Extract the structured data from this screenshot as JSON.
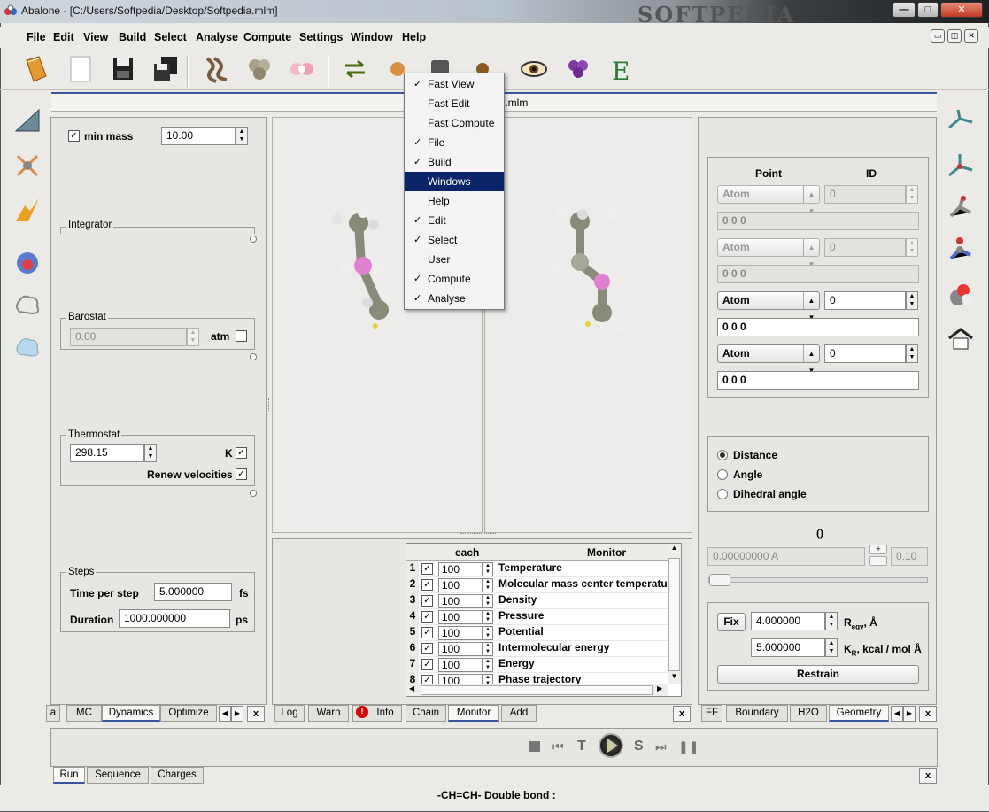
{
  "window": {
    "title": "Abalone - [C:/Users/Softpedia/Desktop/Softpedia.mlm]",
    "watermark": "SOFTPEDIA",
    "min": "—",
    "max": "□",
    "close": "✕"
  },
  "menubar": [
    "File",
    "Edit",
    "View",
    "Build",
    "Select",
    "Analyse",
    "Compute",
    "Settings",
    "Window",
    "Help"
  ],
  "document_tab": "Softpedia.mlm",
  "left_panel": {
    "min_mass_label": "min mass",
    "min_mass_value": "10.00",
    "integrator_title": "Integrator",
    "barostat_title": "Barostat",
    "barostat_value": "0.00",
    "barostat_unit": "atm",
    "thermostat_title": "Thermostat",
    "thermostat_value": "298.15",
    "thermostat_unit": "K",
    "renew_label": "Renew velocities",
    "steps_title": "Steps",
    "time_per_step_label": "Time per step",
    "time_per_step_value": "5.000000",
    "time_unit": "fs",
    "duration_label": "Duration",
    "duration_value": "1000.000000",
    "duration_unit": "ps",
    "tabs": [
      "a",
      "MC",
      "Dynamics",
      "Optimize"
    ]
  },
  "popup_menu": [
    {
      "label": "Fast View",
      "checked": "✓"
    },
    {
      "label": "Fast Edit",
      "checked": ""
    },
    {
      "label": "Fast Compute",
      "checked": ""
    },
    {
      "label": "File",
      "checked": "✓"
    },
    {
      "label": "Build",
      "checked": "✓"
    },
    {
      "label": "Windows",
      "checked": ""
    },
    {
      "label": "Help",
      "checked": ""
    },
    {
      "label": "Edit",
      "checked": "✓"
    },
    {
      "label": "Select",
      "checked": "✓"
    },
    {
      "label": "User",
      "checked": ""
    },
    {
      "label": "Compute",
      "checked": "✓"
    },
    {
      "label": "Analyse",
      "checked": "✓"
    }
  ],
  "monitor": {
    "col_each": "each",
    "col_monitor": "Monitor",
    "rows": [
      {
        "n": "1",
        "each": "100",
        "name": "Temperature"
      },
      {
        "n": "2",
        "each": "100",
        "name": "Molecular mass center temperatur"
      },
      {
        "n": "3",
        "each": "100",
        "name": "Density"
      },
      {
        "n": "4",
        "each": "100",
        "name": "Pressure"
      },
      {
        "n": "5",
        "each": "100",
        "name": "Potential"
      },
      {
        "n": "6",
        "each": "100",
        "name": "Intermolecular energy"
      },
      {
        "n": "7",
        "each": "100",
        "name": "Energy"
      },
      {
        "n": "8",
        "each": "100",
        "name": "Phase trajectory"
      }
    ],
    "tabs": [
      "Log",
      "Warn",
      "Info",
      "Chain",
      "Monitor",
      "Add"
    ]
  },
  "right_panel": {
    "point_header": "Point",
    "id_header": "ID",
    "atoms": [
      {
        "combo": "Atom",
        "id": "0",
        "coords": "0 0 0",
        "enabled": "no"
      },
      {
        "combo": "Atom",
        "id": "0",
        "coords": "0 0 0",
        "enabled": "no"
      },
      {
        "combo": "Atom",
        "id": "0",
        "coords": "0 0 0",
        "enabled": "yes"
      },
      {
        "combo": "Atom",
        "id": "0",
        "coords": "0 0 0",
        "enabled": "yes"
      }
    ],
    "radio": [
      "Distance",
      "Angle",
      "Dihedral angle"
    ],
    "value_title": "()",
    "value_field": "0.00000000 A",
    "value_step": "0.10",
    "fix_label": "Fix",
    "r_value": "4.000000",
    "r_label": "R",
    "r_sub": "eqv",
    "r_unit": ", Å",
    "k_value": "5.000000",
    "k_label": "K",
    "k_sub": "R",
    "k_unit": ", kcal / mol Å",
    "restrain_label": "Restrain",
    "tabs": [
      "FF",
      "Boundary",
      "H2O",
      "Geometry"
    ]
  },
  "bottom": {
    "tabs": [
      "Run",
      "Sequence",
      "Charges"
    ],
    "player": {
      "t": "T",
      "s": "S"
    }
  },
  "status": "-CH=CH- Double bond :",
  "colors": {
    "accent": "#0a246a",
    "tab_active_line": "#3a55a0"
  }
}
